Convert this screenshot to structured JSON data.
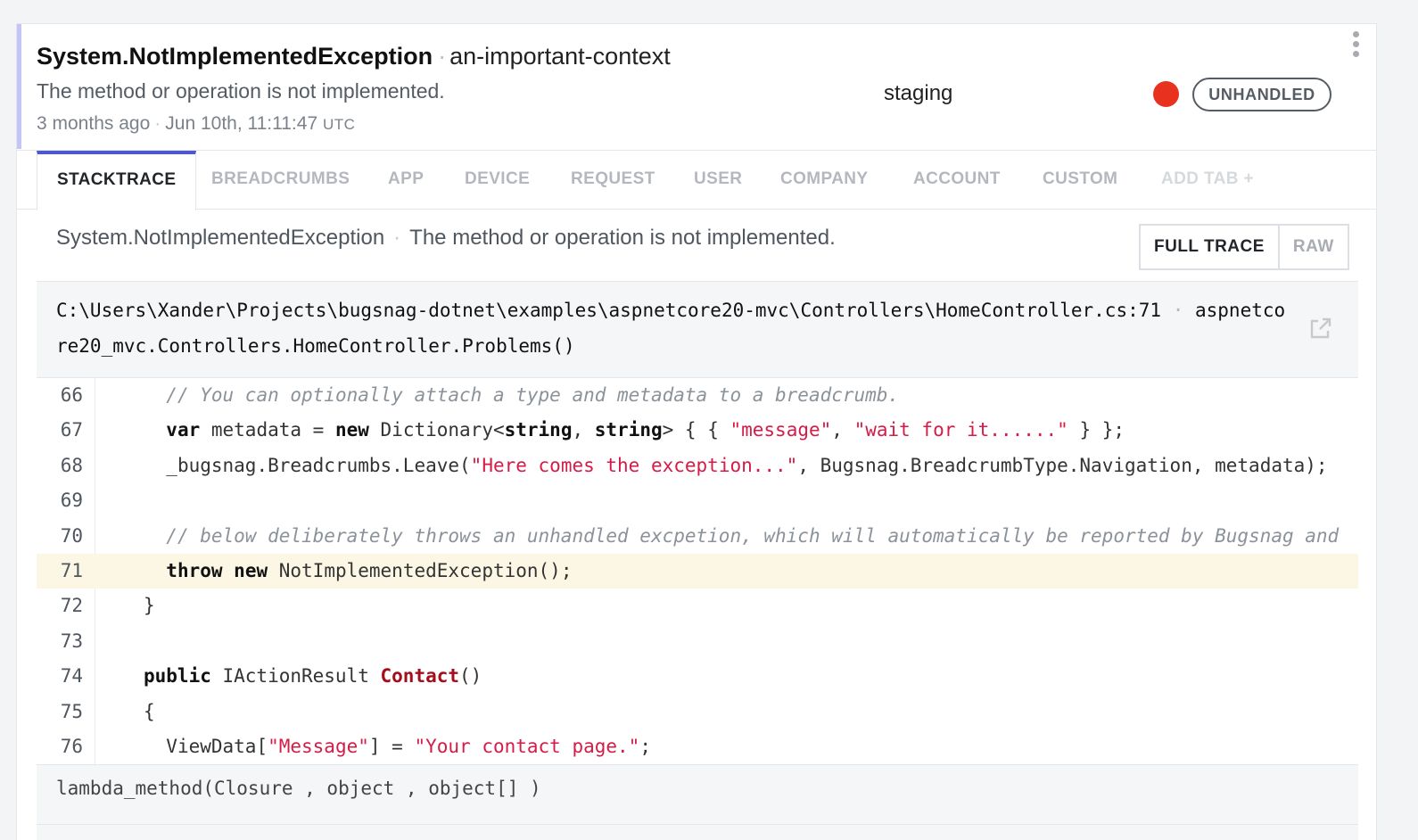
{
  "error": {
    "class": "System.NotImplementedException",
    "context": "an-important-context",
    "message": "The method or operation is not implemented.",
    "relative_time": "3 months ago",
    "timestamp": "Jun 10th, 11:11:47",
    "timezone": "UTC",
    "release_stage": "staging",
    "severity_color": "#e8321f",
    "handled_badge": "UNHANDLED"
  },
  "tabs": [
    {
      "label": "STACKTRACE",
      "active": true
    },
    {
      "label": "BREADCRUMBS"
    },
    {
      "label": "APP"
    },
    {
      "label": "DEVICE"
    },
    {
      "label": "REQUEST"
    },
    {
      "label": "USER"
    },
    {
      "label": "COMPANY"
    },
    {
      "label": "ACCOUNT"
    },
    {
      "label": "CUSTOM"
    },
    {
      "label": "ADD TAB +"
    }
  ],
  "stacktrace": {
    "exception_class": "System.NotImplementedException",
    "exception_message": "The method or operation is not implemented.",
    "full_trace_label": "FULL TRACE",
    "raw_label": "RAW",
    "frame": {
      "file": "C:\\Users\\Xander\\Projects\\bugsnag-dotnet\\examples\\aspnetcore20-mvc\\Controllers\\HomeController.cs:71",
      "method": "aspnetcore20_mvc.Controllers.HomeController.Problems()"
    },
    "highlight_line": 71,
    "lines": [
      {
        "n": "66",
        "indent": "  ",
        "segs": [
          [
            "cm",
            "// You can optionally attach a type and metadata to a breadcrumb."
          ]
        ]
      },
      {
        "n": "67",
        "indent": "  ",
        "segs": [
          [
            "kw",
            "var"
          ],
          [
            "",
            " metadata = "
          ],
          [
            "kw",
            "new"
          ],
          [
            "",
            " Dictionary<"
          ],
          [
            "kw",
            "string"
          ],
          [
            "",
            ", "
          ],
          [
            "kw",
            "string"
          ],
          [
            "",
            "> { { "
          ],
          [
            "str",
            "\"message\""
          ],
          [
            "",
            ", "
          ],
          [
            "str",
            "\"wait for it......\""
          ],
          [
            "",
            " } };"
          ]
        ]
      },
      {
        "n": "68",
        "indent": "  ",
        "segs": [
          [
            "",
            "_bugsnag.Breadcrumbs.Leave("
          ],
          [
            "str",
            "\"Here comes the exception...\""
          ],
          [
            "",
            ", Bugsnag.BreadcrumbType.Navigation, metadata);"
          ]
        ]
      },
      {
        "n": "69",
        "indent": "",
        "segs": []
      },
      {
        "n": "70",
        "indent": "  ",
        "segs": [
          [
            "cm",
            "// below deliberately throws an unhandled excpetion, which will automatically be reported by Bugsnag and"
          ]
        ]
      },
      {
        "n": "71",
        "indent": "  ",
        "segs": [
          [
            "kw",
            "throw"
          ],
          [
            "",
            " "
          ],
          [
            "kw",
            "new"
          ],
          [
            "",
            " NotImplementedException();"
          ]
        ]
      },
      {
        "n": "72",
        "indent": "",
        "segs": [
          [
            "",
            "}"
          ]
        ]
      },
      {
        "n": "73",
        "indent": "",
        "segs": []
      },
      {
        "n": "74",
        "indent": "",
        "segs": [
          [
            "kw",
            "public"
          ],
          [
            "",
            " IActionResult "
          ],
          [
            "fn",
            "Contact"
          ],
          [
            "",
            "()"
          ]
        ]
      },
      {
        "n": "75",
        "indent": "",
        "segs": [
          [
            "",
            "{"
          ]
        ]
      },
      {
        "n": "76",
        "indent": "  ",
        "segs": [
          [
            "",
            "ViewData["
          ],
          [
            "str",
            "\"Message\""
          ],
          [
            "",
            "] = "
          ],
          [
            "str",
            "\"Your contact page.\""
          ],
          [
            "",
            ";"
          ]
        ]
      }
    ],
    "next_frame": "lambda_method(Closure , object , object[] )"
  }
}
